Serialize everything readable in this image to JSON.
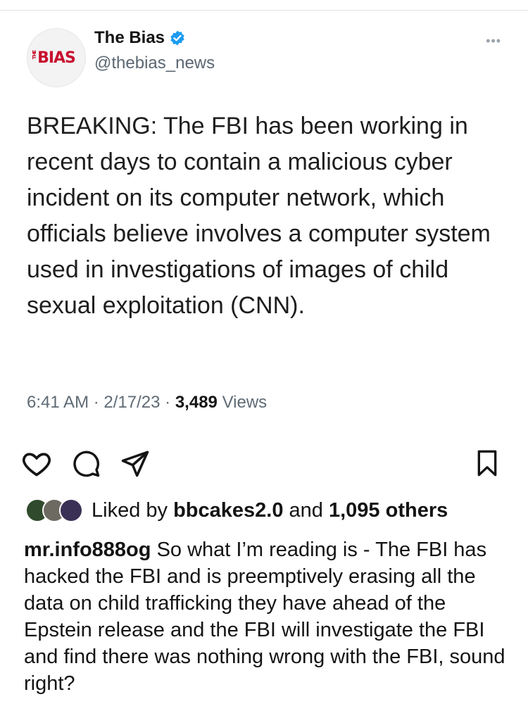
{
  "tweet": {
    "display_name": "The Bias",
    "handle": "@thebias_news",
    "logo_text": "BIAS",
    "logo_prefix": "THE",
    "text": "BREAKING: The FBI has been working in recent days to contain a malicious cyber incident on its computer network, which officials believe involves a computer system used in investigations of images of child sexual exploitation (CNN).",
    "time": "6:41 AM",
    "date": "2/17/23",
    "separator": "·",
    "views_count": "3,489",
    "views_label": "Views"
  },
  "post": {
    "liked_by_prefix": "Liked by",
    "liked_by_user": "bbcakes2.0",
    "liked_by_and": "and",
    "liked_by_others": "1,095 others",
    "caption_user": "mr.info888og",
    "caption_text": "So what I’m reading is - The FBI has hacked the FBI and is preemptively erasing all the data on child trafficking they have ahead of the Epstein release and the FBI will investigate the FBI and find there was nothing wrong with the FBI, sound right?"
  },
  "icons": {
    "like": "heart-icon",
    "comment": "comment-icon",
    "share": "send-icon",
    "save": "bookmark-icon",
    "verified": "verified-badge-icon",
    "more": "more-icon"
  },
  "colors": {
    "brand_red": "#c8102e",
    "verified_blue": "#1d9bf0",
    "muted_text": "#5f6b75"
  }
}
